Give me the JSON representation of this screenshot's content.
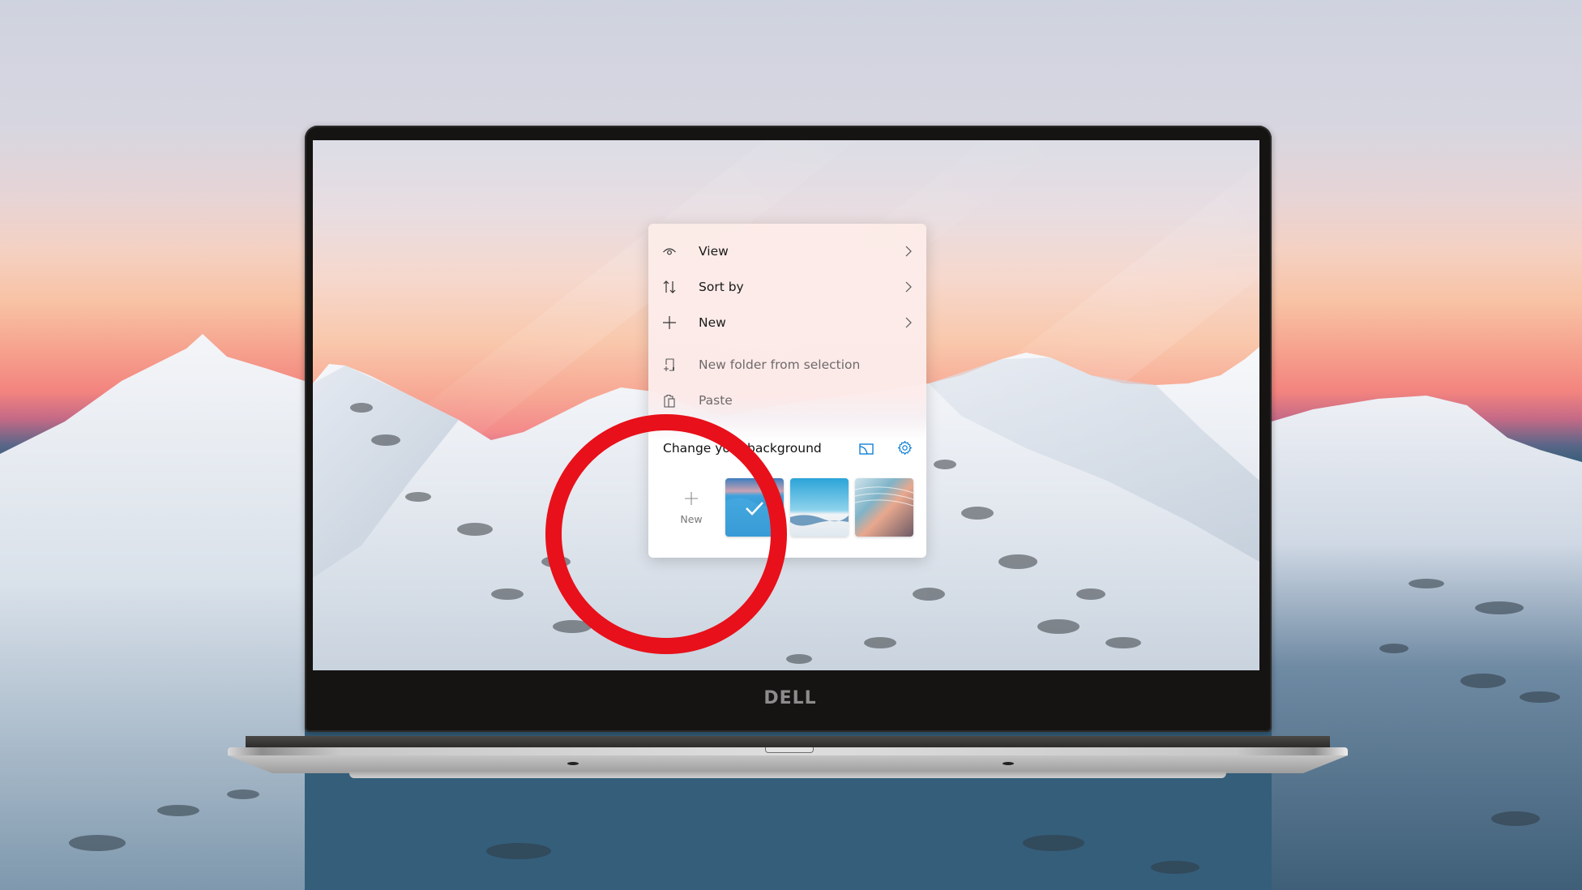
{
  "scene": {
    "description_label": "Dell laptop displaying Windows desktop context menu",
    "brand_logo_text": "DELL"
  },
  "context_menu": {
    "items": [
      {
        "label": "View",
        "icon": "eye-icon",
        "has_submenu": true,
        "enabled": true
      },
      {
        "label": "Sort by",
        "icon": "sort-arrows-icon",
        "has_submenu": true,
        "enabled": true
      },
      {
        "label": "New",
        "icon": "plus-icon",
        "has_submenu": true,
        "enabled": true
      },
      {
        "label": "New folder from selection",
        "icon": "new-folder-icon",
        "has_submenu": false,
        "enabled": false
      },
      {
        "label": "Paste",
        "icon": "clipboard-icon",
        "has_submenu": false,
        "enabled": false
      }
    ],
    "background_section": {
      "title": "Change your background",
      "slideshow_icon": "slideshow-icon",
      "settings_icon": "gear-icon",
      "new_tile_label": "New",
      "thumbnails": [
        {
          "name": "blue-snow-dune",
          "selected": true
        },
        {
          "name": "white-desert-sky",
          "selected": false
        },
        {
          "name": "coral-beach-waves",
          "selected": false
        }
      ]
    }
  },
  "colors": {
    "accent": "#0078d4",
    "annotation_red": "#e8101a",
    "menu_text": "#1a1a1a",
    "disabled_text": "#6f6a6a"
  }
}
